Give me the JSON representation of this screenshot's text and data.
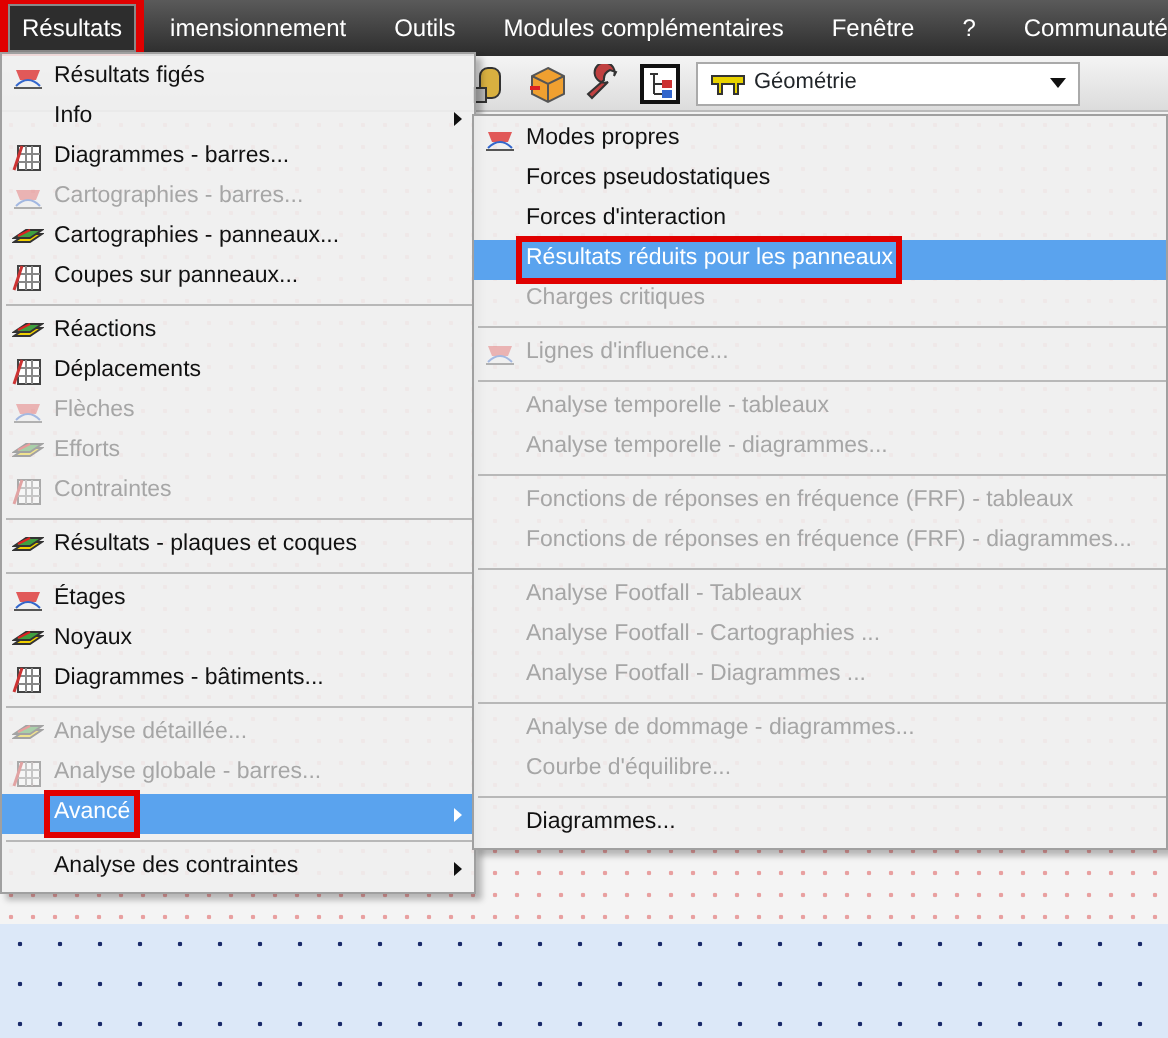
{
  "menubar": [
    {
      "label": "Résultats",
      "selected": true,
      "highlighted": true
    },
    {
      "label": "imensionnement",
      "selected": false,
      "highlighted": false
    },
    {
      "label": "Outils",
      "selected": false,
      "highlighted": false
    },
    {
      "label": "Modules complémentaires",
      "selected": false,
      "highlighted": false
    },
    {
      "label": "Fenêtre",
      "selected": false,
      "highlighted": false
    },
    {
      "label": "?",
      "selected": false,
      "highlighted": false
    },
    {
      "label": "Communauté",
      "selected": false,
      "highlighted": false
    }
  ],
  "toolbar": {
    "dropdown": {
      "value": "Géométrie"
    }
  },
  "menu": {
    "items": [
      {
        "kind": "item",
        "label": "Résultats figés",
        "icon": true,
        "disabled": false,
        "selected": false,
        "submenu": false,
        "highlighted": false
      },
      {
        "kind": "item",
        "label": "Info",
        "icon": false,
        "disabled": false,
        "selected": false,
        "submenu": true,
        "highlighted": false
      },
      {
        "kind": "item",
        "label": "Diagrammes - barres...",
        "icon": true,
        "disabled": false,
        "selected": false,
        "submenu": false,
        "highlighted": false
      },
      {
        "kind": "item",
        "label": "Cartographies - barres...",
        "icon": true,
        "disabled": true,
        "selected": false,
        "submenu": false,
        "highlighted": false
      },
      {
        "kind": "item",
        "label": "Cartographies - panneaux...",
        "icon": true,
        "disabled": false,
        "selected": false,
        "submenu": false,
        "highlighted": false
      },
      {
        "kind": "item",
        "label": "Coupes sur panneaux...",
        "icon": true,
        "disabled": false,
        "selected": false,
        "submenu": false,
        "highlighted": false
      },
      {
        "kind": "separator"
      },
      {
        "kind": "item",
        "label": "Réactions",
        "icon": true,
        "disabled": false,
        "selected": false,
        "submenu": false,
        "highlighted": false
      },
      {
        "kind": "item",
        "label": "Déplacements",
        "icon": true,
        "disabled": false,
        "selected": false,
        "submenu": false,
        "highlighted": false
      },
      {
        "kind": "item",
        "label": "Flèches",
        "icon": true,
        "disabled": true,
        "selected": false,
        "submenu": false,
        "highlighted": false
      },
      {
        "kind": "item",
        "label": "Efforts",
        "icon": true,
        "disabled": true,
        "selected": false,
        "submenu": false,
        "highlighted": false
      },
      {
        "kind": "item",
        "label": "Contraintes",
        "icon": true,
        "disabled": true,
        "selected": false,
        "submenu": false,
        "highlighted": false
      },
      {
        "kind": "separator"
      },
      {
        "kind": "item",
        "label": "Résultats - plaques et coques",
        "icon": true,
        "disabled": false,
        "selected": false,
        "submenu": false,
        "highlighted": false
      },
      {
        "kind": "separator"
      },
      {
        "kind": "item",
        "label": "Étages",
        "icon": true,
        "disabled": false,
        "selected": false,
        "submenu": false,
        "highlighted": false
      },
      {
        "kind": "item",
        "label": "Noyaux",
        "icon": true,
        "disabled": false,
        "selected": false,
        "submenu": false,
        "highlighted": false
      },
      {
        "kind": "item",
        "label": "Diagrammes - bâtiments...",
        "icon": true,
        "disabled": false,
        "selected": false,
        "submenu": false,
        "highlighted": false
      },
      {
        "kind": "separator"
      },
      {
        "kind": "item",
        "label": "Analyse détaillée...",
        "icon": true,
        "disabled": true,
        "selected": false,
        "submenu": false,
        "highlighted": false
      },
      {
        "kind": "item",
        "label": "Analyse globale - barres...",
        "icon": true,
        "disabled": true,
        "selected": false,
        "submenu": false,
        "highlighted": false
      },
      {
        "kind": "item",
        "label": "Avancé",
        "icon": false,
        "disabled": false,
        "selected": true,
        "submenu": true,
        "highlighted": true
      },
      {
        "kind": "separator"
      },
      {
        "kind": "item",
        "label": "Analyse des contraintes",
        "icon": false,
        "disabled": false,
        "selected": false,
        "submenu": true,
        "highlighted": false
      }
    ]
  },
  "submenu": {
    "items": [
      {
        "kind": "item",
        "label": "Modes propres",
        "icon": true,
        "disabled": false,
        "selected": false,
        "highlighted": false
      },
      {
        "kind": "item",
        "label": "Forces pseudostatiques",
        "icon": false,
        "disabled": false,
        "selected": false,
        "highlighted": false
      },
      {
        "kind": "item",
        "label": "Forces d'interaction",
        "icon": false,
        "disabled": false,
        "selected": false,
        "highlighted": false
      },
      {
        "kind": "item",
        "label": "Résultats réduits pour les panneaux",
        "icon": false,
        "disabled": false,
        "selected": true,
        "highlighted": true
      },
      {
        "kind": "item",
        "label": "Charges critiques",
        "icon": false,
        "disabled": true,
        "selected": false,
        "highlighted": false
      },
      {
        "kind": "separator"
      },
      {
        "kind": "item",
        "label": "Lignes d'influence...",
        "icon": true,
        "disabled": true,
        "selected": false,
        "highlighted": false
      },
      {
        "kind": "separator"
      },
      {
        "kind": "item",
        "label": "Analyse temporelle - tableaux",
        "icon": false,
        "disabled": true,
        "selected": false,
        "highlighted": false
      },
      {
        "kind": "item",
        "label": "Analyse temporelle - diagrammes...",
        "icon": false,
        "disabled": true,
        "selected": false,
        "highlighted": false
      },
      {
        "kind": "separator"
      },
      {
        "kind": "item",
        "label": "Fonctions de réponses en fréquence (FRF) - tableaux",
        "icon": false,
        "disabled": true,
        "selected": false,
        "highlighted": false
      },
      {
        "kind": "item",
        "label": "Fonctions de réponses en fréquence (FRF) - diagrammes...",
        "icon": false,
        "disabled": true,
        "selected": false,
        "highlighted": false
      },
      {
        "kind": "separator"
      },
      {
        "kind": "item",
        "label": "Analyse Footfall - Tableaux",
        "icon": false,
        "disabled": true,
        "selected": false,
        "highlighted": false
      },
      {
        "kind": "item",
        "label": "Analyse Footfall - Cartographies ...",
        "icon": false,
        "disabled": true,
        "selected": false,
        "highlighted": false
      },
      {
        "kind": "item",
        "label": "Analyse Footfall - Diagrammes ...",
        "icon": false,
        "disabled": true,
        "selected": false,
        "highlighted": false
      },
      {
        "kind": "separator"
      },
      {
        "kind": "item",
        "label": "Analyse de dommage - diagrammes...",
        "icon": false,
        "disabled": true,
        "selected": false,
        "highlighted": false
      },
      {
        "kind": "item",
        "label": "Courbe d'équilibre...",
        "icon": false,
        "disabled": true,
        "selected": false,
        "highlighted": false
      },
      {
        "kind": "separator"
      },
      {
        "kind": "item",
        "label": "Diagrammes...",
        "icon": false,
        "disabled": false,
        "selected": false,
        "highlighted": false
      }
    ]
  }
}
